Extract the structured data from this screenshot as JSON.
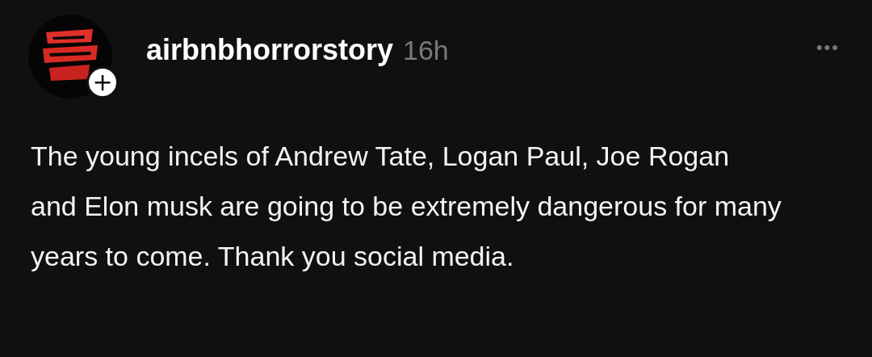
{
  "post": {
    "author": "airbnbhorrorstory",
    "time": "16h",
    "follow_badge": "+",
    "more": "•••",
    "text": "The young incels of Andrew Tate, Logan Paul, Joe Rogan and Elon musk are going to be extremely dangerous for many years to come. Thank you social media."
  }
}
